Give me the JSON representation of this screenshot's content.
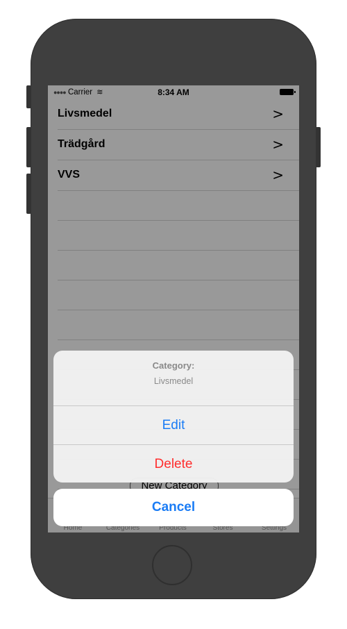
{
  "status_bar": {
    "carrier": "Carrier",
    "time": "8:34 AM"
  },
  "list": {
    "items": [
      {
        "label": "Livsmedel"
      },
      {
        "label": "Trädgård"
      },
      {
        "label": "VVS"
      }
    ]
  },
  "new_category_button": "New Category",
  "tab_bar": {
    "tabs": [
      "Home",
      "Categories",
      "Products",
      "Stores",
      "Settings"
    ]
  },
  "action_sheet": {
    "title": "Category:",
    "message": "Livsmedel",
    "edit_label": "Edit",
    "delete_label": "Delete",
    "cancel_label": "Cancel"
  },
  "colors": {
    "accent": "#1a7cf5",
    "destructive": "#ff2d2d",
    "phone_frame": "#3f3f3f"
  }
}
